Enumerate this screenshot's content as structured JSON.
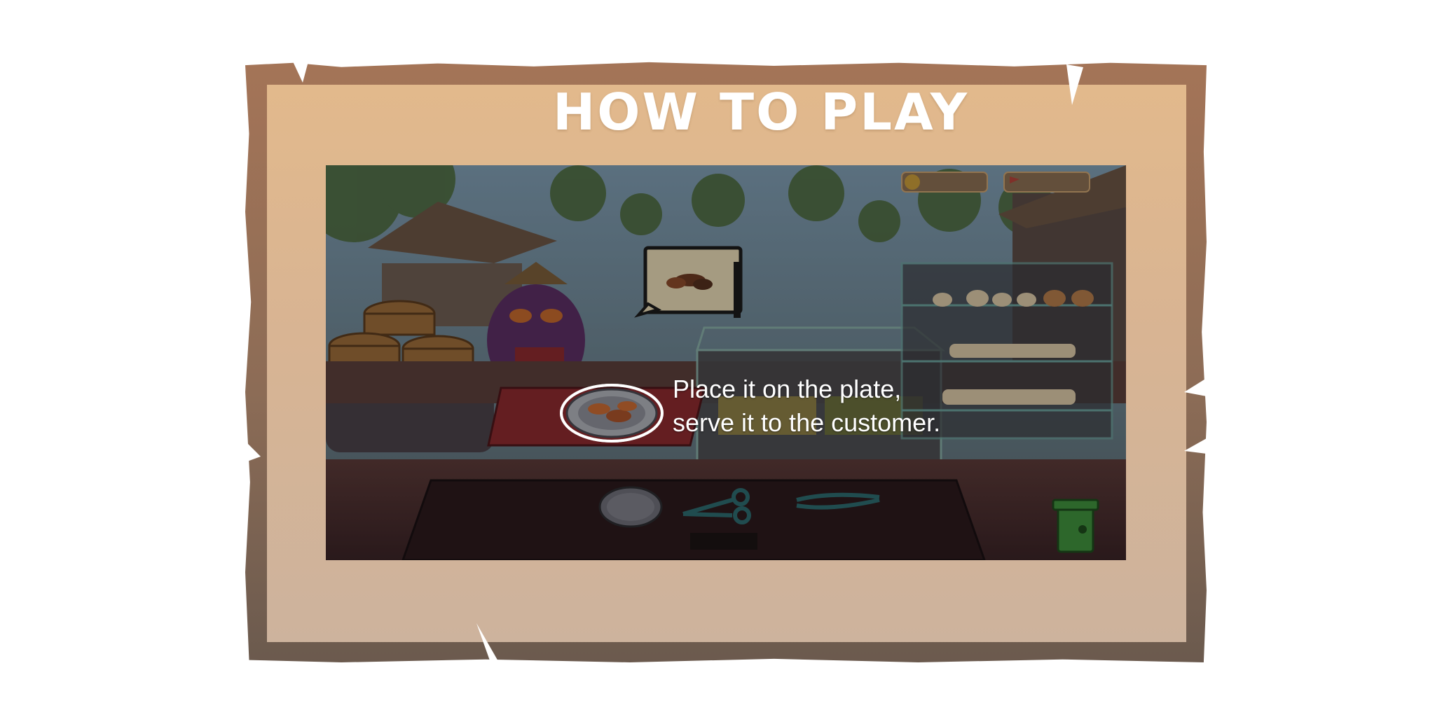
{
  "screen": {
    "title": "HOW TO PLAY",
    "instruction_lines": [
      "Place it on the plate,",
      "serve it to the customer."
    ]
  },
  "hud": {
    "coin_icon": "coin-icon",
    "flag_icon": "flag-icon"
  },
  "order": {
    "item_icon": "sausage-icon"
  },
  "tools": [
    "plate-icon",
    "scissors-icon",
    "tongs-icon"
  ],
  "colors": {
    "frame_dark": "#8c6c56",
    "frame_light": "#e2b98c",
    "highlight": "#ffffff",
    "trash": "#3f8f3c"
  }
}
